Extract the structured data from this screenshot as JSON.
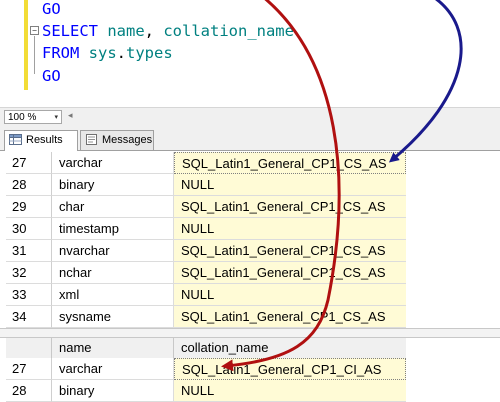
{
  "editor": {
    "lines": [
      {
        "tokens": [
          {
            "t": "GO",
            "c": "kw"
          }
        ]
      },
      {
        "tokens": [
          {
            "t": "SELECT ",
            "c": "kw"
          },
          {
            "t": "name",
            "c": "fn"
          },
          {
            "t": ", ",
            "c": "plain"
          },
          {
            "t": "collation_name",
            "c": "fn"
          }
        ]
      },
      {
        "tokens": [
          {
            "t": "FROM ",
            "c": "kw"
          },
          {
            "t": "sys",
            "c": "fn"
          },
          {
            "t": ".",
            "c": "plain"
          },
          {
            "t": "types",
            "c": "fn"
          }
        ]
      },
      {
        "tokens": [
          {
            "t": "GO",
            "c": "kw"
          }
        ]
      }
    ],
    "collapse_glyph": "−"
  },
  "zoom": {
    "value": "100 %",
    "arrow": "▾",
    "scroll_arrow": "◂"
  },
  "tabs": {
    "results": "Results",
    "messages": "Messages"
  },
  "grid1": {
    "rows": [
      {
        "num": "27",
        "name": "varchar",
        "collation": "SQL_Latin1_General_CP1_CS_AS"
      },
      {
        "num": "28",
        "name": "binary",
        "collation": "NULL"
      },
      {
        "num": "29",
        "name": "char",
        "collation": "SQL_Latin1_General_CP1_CS_AS"
      },
      {
        "num": "30",
        "name": "timestamp",
        "collation": "NULL"
      },
      {
        "num": "31",
        "name": "nvarchar",
        "collation": "SQL_Latin1_General_CP1_CS_AS"
      },
      {
        "num": "32",
        "name": "nchar",
        "collation": "SQL_Latin1_General_CP1_CS_AS"
      },
      {
        "num": "33",
        "name": "xml",
        "collation": "NULL"
      },
      {
        "num": "34",
        "name": "sysname",
        "collation": "SQL_Latin1_General_CP1_CS_AS"
      }
    ]
  },
  "grid2": {
    "columns": {
      "name": "name",
      "collation": "collation_name"
    },
    "rows": [
      {
        "num": "27",
        "name": "varchar",
        "collation": "SQL_Latin1_General_CP1_CI_AS"
      },
      {
        "num": "28",
        "name": "binary",
        "collation": "NULL"
      }
    ]
  },
  "colors": {
    "keyword": "#0000ff",
    "identifier": "#008080",
    "blue_arrow": "#1a1a8c",
    "red_arrow": "#b01010",
    "cell_highlight": "#fffbd6"
  }
}
